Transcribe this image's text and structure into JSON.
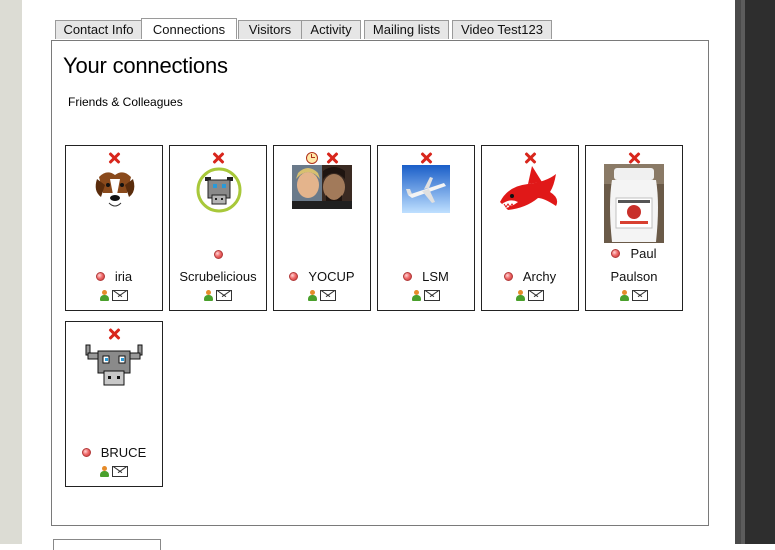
{
  "tabs": [
    {
      "label": "Contact Info",
      "active": false
    },
    {
      "label": "Connections",
      "active": true
    },
    {
      "label": "Visitors",
      "active": false
    },
    {
      "label": "Activity",
      "active": false
    },
    {
      "label": "Mailing lists",
      "active": false
    },
    {
      "label": "Video Test123",
      "active": false
    }
  ],
  "panel": {
    "title": "Your connections",
    "subtitle": "Friends & Colleagues"
  },
  "connections": [
    {
      "name": "iria",
      "avatar": "dog-photo",
      "status": "offline"
    },
    {
      "name": "Scrubelicious",
      "avatar": "pixel-cow-in-circle",
      "status": "offline"
    },
    {
      "name": "YOCUP",
      "avatar": "two-people-photo",
      "status": "offline",
      "extra_icon": "clock-icon"
    },
    {
      "name": "LSM",
      "avatar": "airplane-photo",
      "status": "offline"
    },
    {
      "name": "Archy",
      "avatar": "red-shark",
      "status": "offline"
    },
    {
      "name_line1": "Paul",
      "name_line2": "Paulson",
      "avatar": "sauce-bottle-photo",
      "status": "offline"
    },
    {
      "name": "BRUCE",
      "avatar": "pixel-cow",
      "status": "offline"
    }
  ],
  "colors": {
    "remove": "#d8261c",
    "status_offline": "#e05050",
    "right_rail": "#2e2e2e",
    "left_gutter": "#dcdcd4"
  }
}
